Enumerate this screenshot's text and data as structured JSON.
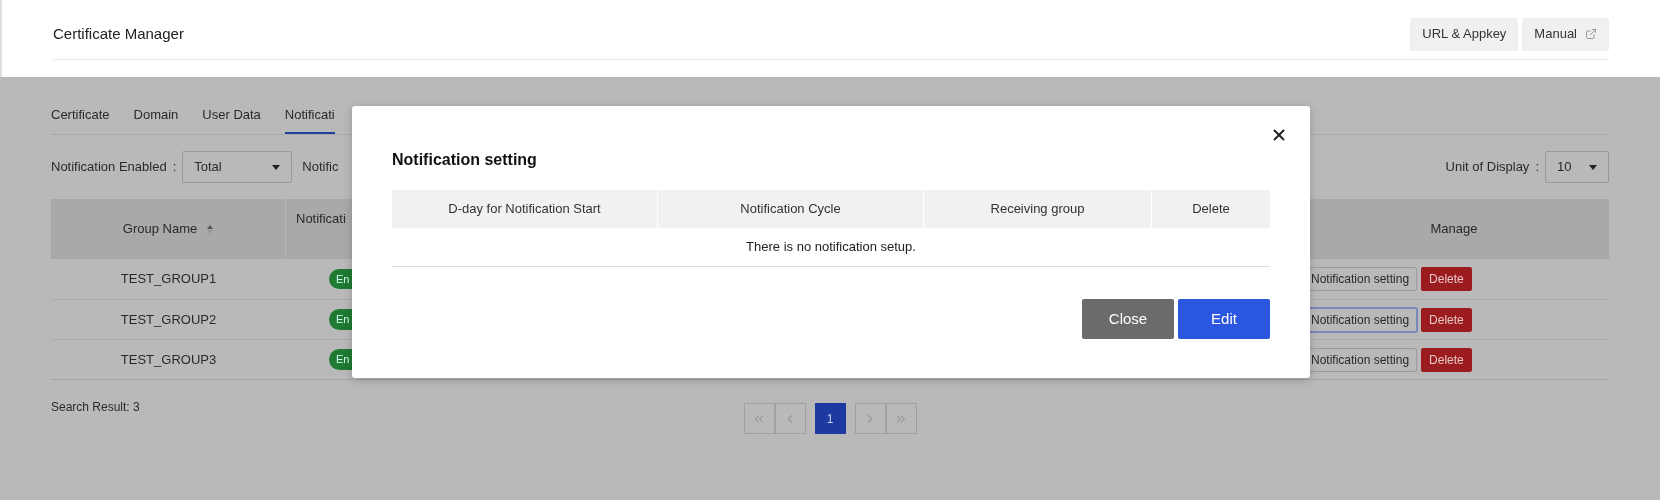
{
  "header": {
    "title": "Certificate Manager",
    "buttons": [
      {
        "label": "URL & Appkey",
        "kind": "plain"
      },
      {
        "label": "Manual",
        "kind": "external"
      }
    ]
  },
  "tabs": [
    {
      "label": "Certificate",
      "selected": false
    },
    {
      "label": "Domain",
      "selected": false
    },
    {
      "label": "User Data",
      "selected": false
    },
    {
      "label": "Notificati",
      "selected": true
    }
  ],
  "filters": {
    "enabled_label": "Notification Enabled",
    "separator": ":",
    "enabled_value": "Total",
    "second_label": "Notific",
    "unit_label": "Unit of Display",
    "unit_value": "10"
  },
  "table": {
    "columns": [
      {
        "label": "Group Name",
        "sortable": true
      },
      {
        "label": "Notificati",
        "sortable": false
      },
      {
        "label": "Manage",
        "sortable": false
      }
    ],
    "rows": [
      {
        "group": "TEST_GROUP1",
        "badge": "En",
        "settings": "Notification setting",
        "focused": false,
        "delete": "Delete"
      },
      {
        "group": "TEST_GROUP2",
        "badge": "En",
        "settings": "Notification setting",
        "focused": true,
        "delete": "Delete"
      },
      {
        "group": "TEST_GROUP3",
        "badge": "En",
        "settings": "Notification setting",
        "focused": false,
        "delete": "Delete"
      }
    ]
  },
  "search_result": "Search Result: 3",
  "pagination": [
    {
      "kind": "first",
      "selected": false,
      "disabled": true
    },
    {
      "kind": "prev",
      "selected": false,
      "disabled": true
    },
    {
      "kind": "page",
      "label": "1",
      "selected": true,
      "disabled": false
    },
    {
      "kind": "next",
      "selected": false,
      "disabled": true
    },
    {
      "kind": "last",
      "selected": false,
      "disabled": true
    }
  ],
  "modal": {
    "title": "Notification setting",
    "columns": [
      "D-day for Notification Start",
      "Notification Cycle",
      "Receiving group",
      "Delete"
    ],
    "empty": "There is no notification setup.",
    "buttons": [
      {
        "label": "Close",
        "kind": "secondary"
      },
      {
        "label": "Edit",
        "kind": "primary"
      }
    ]
  }
}
